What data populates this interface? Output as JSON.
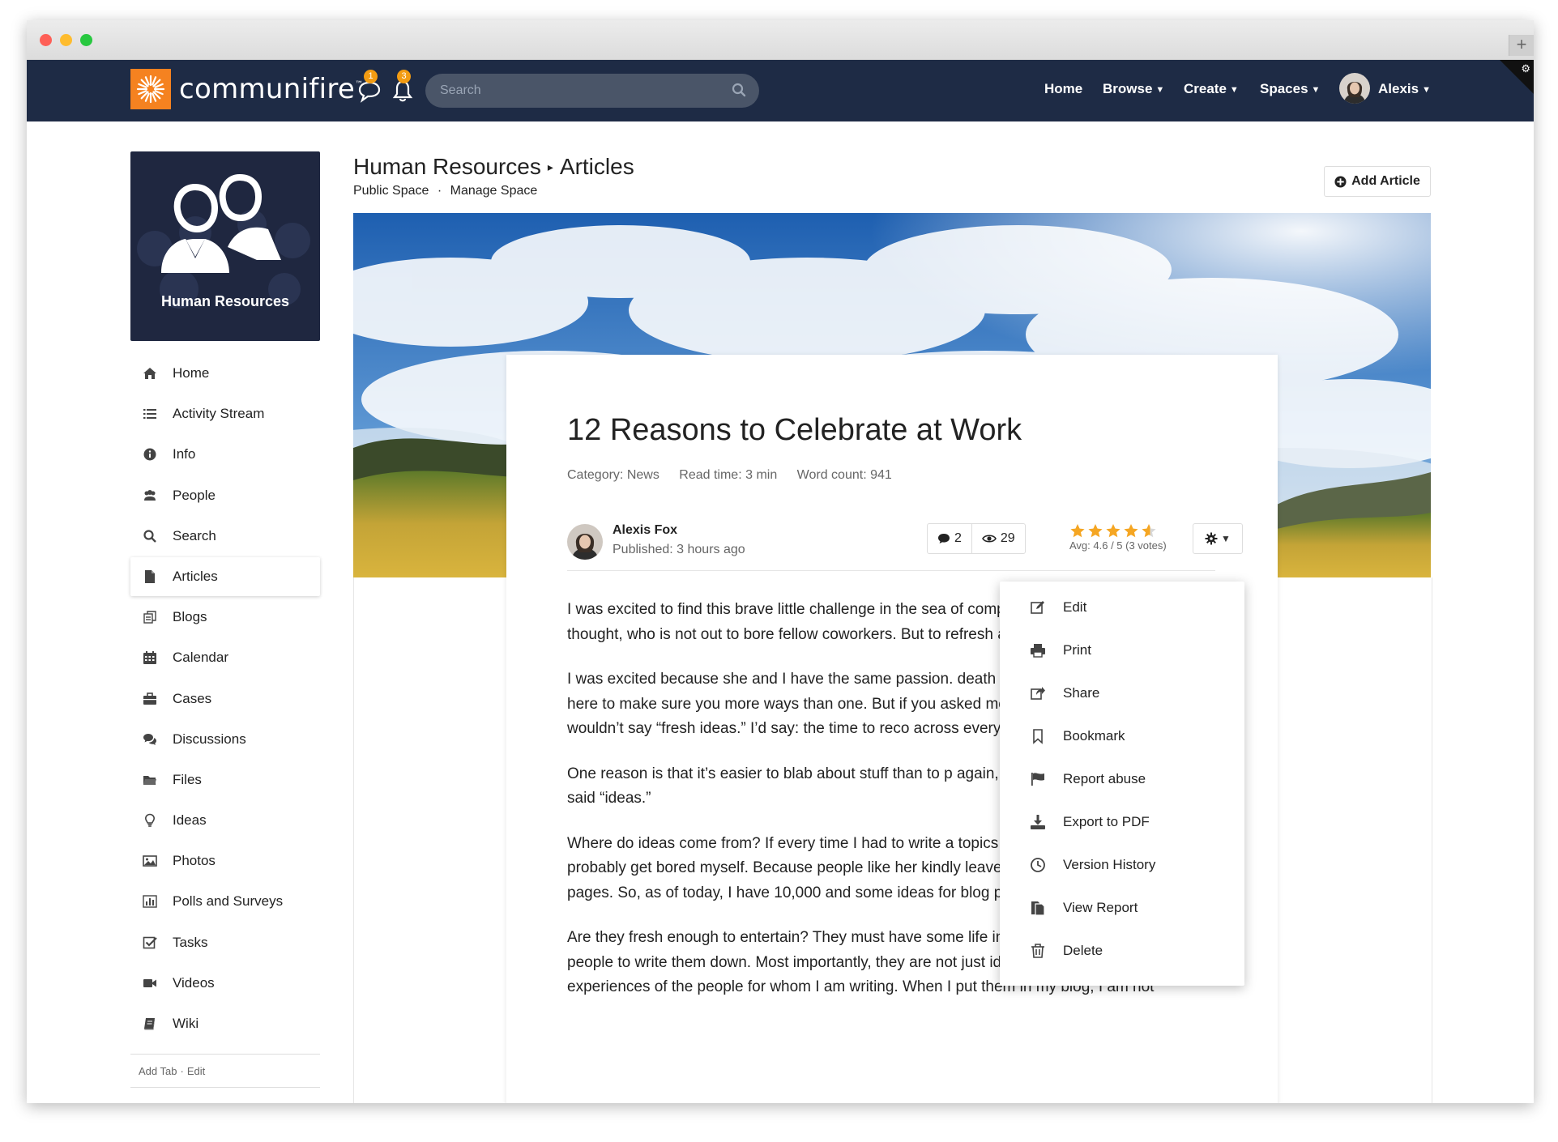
{
  "browser": {
    "new_tab_label": "+"
  },
  "topnav": {
    "brand": "communifire",
    "brand_mark": "™",
    "chat_badge": "1",
    "notif_badge": "3",
    "search_placeholder": "Search",
    "links": {
      "home": "Home",
      "browse": "Browse",
      "create": "Create",
      "spaces": "Spaces"
    },
    "user": "Alexis",
    "colors": {
      "nav_bg": "#1e2b45",
      "brand_orange": "#f58220",
      "badge": "#f39c12"
    }
  },
  "space": {
    "name": "Human Resources"
  },
  "sidebar": {
    "items": [
      {
        "label": "Home",
        "icon": "home-icon"
      },
      {
        "label": "Activity Stream",
        "icon": "list-icon"
      },
      {
        "label": "Info",
        "icon": "info-icon"
      },
      {
        "label": "People",
        "icon": "people-icon"
      },
      {
        "label": "Search",
        "icon": "search-icon"
      },
      {
        "label": "Articles",
        "icon": "document-icon",
        "active": true
      },
      {
        "label": "Blogs",
        "icon": "blog-icon"
      },
      {
        "label": "Calendar",
        "icon": "calendar-icon"
      },
      {
        "label": "Cases",
        "icon": "briefcase-icon"
      },
      {
        "label": "Discussions",
        "icon": "comments-icon"
      },
      {
        "label": "Files",
        "icon": "folder-icon"
      },
      {
        "label": "Ideas",
        "icon": "lightbulb-icon"
      },
      {
        "label": "Photos",
        "icon": "image-icon"
      },
      {
        "label": "Polls and Surveys",
        "icon": "bar-chart-icon"
      },
      {
        "label": "Tasks",
        "icon": "checkbox-icon"
      },
      {
        "label": "Videos",
        "icon": "video-icon"
      },
      {
        "label": "Wiki",
        "icon": "book-icon"
      }
    ],
    "footer": {
      "add_tab": "Add Tab",
      "sep": "·",
      "edit": "Edit"
    }
  },
  "header": {
    "space_title": "Human Resources",
    "section_title": "Articles",
    "public_space": "Public Space",
    "sep": "·",
    "manage_space": "Manage Space",
    "add_article": "Add Article"
  },
  "article": {
    "title": "12 Reasons to Celebrate at Work",
    "category": "Category: News",
    "read_time": "Read time: 3 min",
    "word_count": "Word count: 941",
    "author": "Alexis Fox",
    "published": "Published: 3 hours ago",
    "comments": "2",
    "views": "29",
    "rating_value": 4.6,
    "rating_text": "Avg: 4.6 / 5 (3 votes)",
    "paragraphs": [
      "I was excited to find this brave little challenge in the sea of complaints. Here’s a person, I thought, who is not out to bore fellow coworkers. But to refresh and entertain! This is an",
      "I was excited because she and I have the same passion. death with stale ideas either. I am here to make sure you more ways than one. But if you asked me what my biggest posts, I wouldn’t say “fresh ideas.” I’d say: the time to reco across every day.",
      "One reason is that it’s easier to blab about stuff than to p again, she didn’t say “execution.” She said “ideas.”",
      "Where do ideas come from? If every time I had to write a topics on the Internet, I would probably get bored myself. Because people like her kindly leave their comments on my landing pages. So, as of today, I have 10,000 and some ideas for blog posts.",
      "Are they fresh enough to entertain? They must have some life in them, if they had stirred people to write them down. Most importantly, they are not just ideas. They are real-life experiences of the people for whom I am writing. When I put them in my blog, I am not"
    ]
  },
  "menu": {
    "items": [
      {
        "label": "Edit",
        "icon": "edit-icon"
      },
      {
        "label": "Print",
        "icon": "print-icon"
      },
      {
        "label": "Share",
        "icon": "share-icon"
      },
      {
        "label": "Bookmark",
        "icon": "bookmark-icon"
      },
      {
        "label": "Report abuse",
        "icon": "flag-icon"
      },
      {
        "label": "Export to PDF",
        "icon": "download-icon"
      },
      {
        "label": "Version History",
        "icon": "clock-icon"
      },
      {
        "label": "View Report",
        "icon": "report-icon"
      },
      {
        "label": "Delete",
        "icon": "trash-icon"
      }
    ]
  }
}
